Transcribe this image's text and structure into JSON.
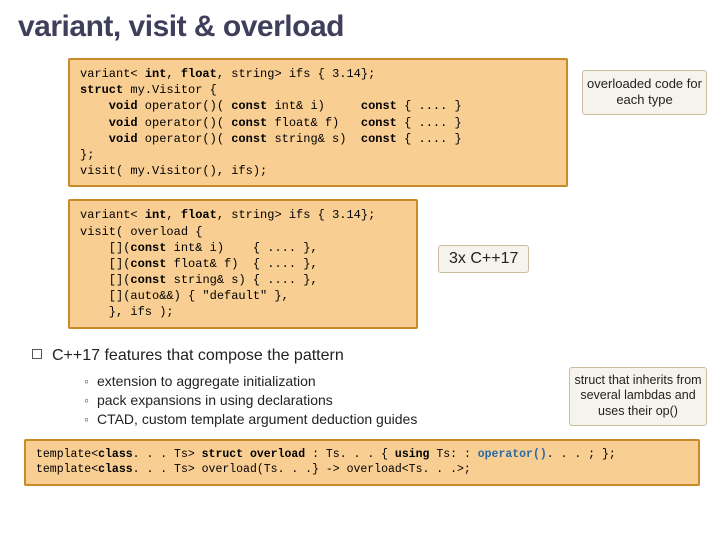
{
  "title": "variant, visit & overload",
  "code1": {
    "l1a": "variant< ",
    "l1b": "int",
    "l1c": ", ",
    "l1d": "float",
    "l1e": ", string> ifs { 3.14};",
    "l2a": "struct",
    "l2b": " my.Visitor {",
    "l3a": "    void",
    "l3b": " operator()( ",
    "l3c": "const",
    "l3d": " int& i)     ",
    "l3e": "const",
    "l3f": " { .... }",
    "l4a": "    void",
    "l4b": " operator()( ",
    "l4c": "const",
    "l4d": " float& f)   ",
    "l4e": "const",
    "l4f": " { .... }",
    "l5a": "    void",
    "l5b": " operator()( ",
    "l5c": "const",
    "l5d": " string& s)  ",
    "l5e": "const",
    "l5f": " { .... }",
    "l6": "};",
    "l7": "visit( my.Visitor(), ifs);"
  },
  "callout1": "overloaded code for each type",
  "code2": {
    "l1a": "variant< ",
    "l1b": "int",
    "l1c": ", ",
    "l1d": "float",
    "l1e": ", string> ifs { 3.14};",
    "l2": "visit( overload {",
    "l3a": "    [](",
    "l3b": "const",
    "l3c": " int& i)    { .... },",
    "l4a": "    [](",
    "l4b": "const",
    "l4c": " float& f)  { .... },",
    "l5a": "    [](",
    "l5b": "const",
    "l5c": " string& s) { .... },",
    "l6": "    [](auto&&) { \"default\" },",
    "l7": "    }, ifs );"
  },
  "callout2": "3x C++17",
  "section_head": "C++17 features that compose the pattern",
  "bullets": {
    "b1": "extension to aggregate initialization",
    "b2": "pack expansions in using declarations",
    "b3": "CTAD, custom template argument deduction guides"
  },
  "callout3": "struct that inherits from several lambdas and uses their op()",
  "code3": {
    "l1a": "template<",
    "l1b": "class",
    "l1c": ". . . Ts> ",
    "l1d": "struct",
    "l1e": " overload",
    "l1f": " : Ts. . . { ",
    "l1g": "using",
    "l1h": " Ts: : ",
    "l1i": "operator()",
    "l1j": ". . . ; };",
    "l2a": "template<",
    "l2b": "class",
    "l2c": ". . . Ts> overload(Ts. . .} -> overload<Ts. . .>;"
  }
}
